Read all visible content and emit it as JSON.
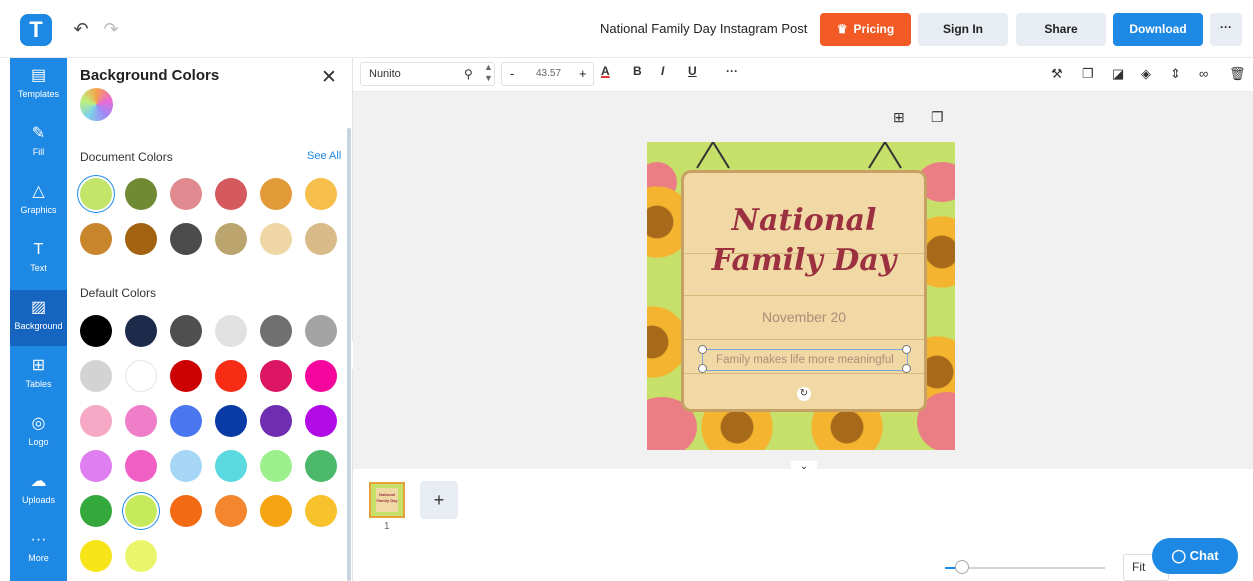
{
  "app": {
    "logo_letter": "T",
    "document_title": "National Family Day Instagram Post"
  },
  "header": {
    "pricing_label": "Pricing",
    "signin_label": "Sign In",
    "share_label": "Share",
    "download_label": "Download",
    "more_label": "···"
  },
  "sidebar": {
    "items": [
      {
        "label": "Templates",
        "icon": "templates-icon"
      },
      {
        "label": "Fill",
        "icon": "pencil-icon"
      },
      {
        "label": "Graphics",
        "icon": "shapes-icon"
      },
      {
        "label": "Text",
        "icon": "text-icon"
      },
      {
        "label": "Background",
        "icon": "background-icon",
        "active": true
      },
      {
        "label": "Tables",
        "icon": "table-icon"
      },
      {
        "label": "Logo",
        "icon": "logo-icon"
      },
      {
        "label": "Uploads",
        "icon": "cloud-upload-icon"
      },
      {
        "label": "More",
        "icon": "more-icon"
      }
    ]
  },
  "panel": {
    "title": "Background Colors",
    "document_colors_label": "Document Colors",
    "see_all_label": "See All",
    "default_colors_label": "Default Colors",
    "document_colors": [
      "#c3e66a",
      "#6f8a33",
      "#e08a8f",
      "#d55a5f",
      "#e29a38",
      "#f6bf4b",
      "#c8852c",
      "#a2620f",
      "#4b4b4b",
      "#bca46e",
      "#eed7a4",
      "#d9bb8a"
    ],
    "default_colors": [
      "#000000",
      "#1d2a4a",
      "#4f4f4f",
      "#e1e1e1",
      "#707070",
      "#a3a3a3",
      "#d3d3d3",
      "#ffffff",
      "#cc0000",
      "#f72c14",
      "#dc1563",
      "#f5079e",
      "#f5a9c4",
      "#ef7ec9",
      "#4a77f0",
      "#0a3aa6",
      "#6f2eb1",
      "#b20ce6",
      "#df7ef0",
      "#f05fc4",
      "#a5d6f6",
      "#5ad9e0",
      "#9ef08f",
      "#4cb96a",
      "#35a83d",
      "#c5ea5c",
      "#f36a14",
      "#f3862e",
      "#f5a310",
      "#f8c22d",
      "#f7e51a",
      "#ebf56c"
    ],
    "selected_document_color": 0,
    "selected_default_color": 25
  },
  "toolbar": {
    "font_name": "Nunito",
    "font_size": "43.57",
    "minus_label": "-",
    "plus_label": "+",
    "color_label": "A",
    "bold_label": "B",
    "italic_label": "I",
    "underline_label": "U",
    "more_label": "···"
  },
  "post": {
    "title": "National Family Day",
    "date": "November 20",
    "tagline": "Family makes life more meaningful"
  },
  "pages": {
    "current_page": "1",
    "thumb_title": "National Family Day"
  },
  "zoom": {
    "fit_label": "Fit",
    "level": 0.06
  },
  "chat": {
    "label": "Chat"
  }
}
